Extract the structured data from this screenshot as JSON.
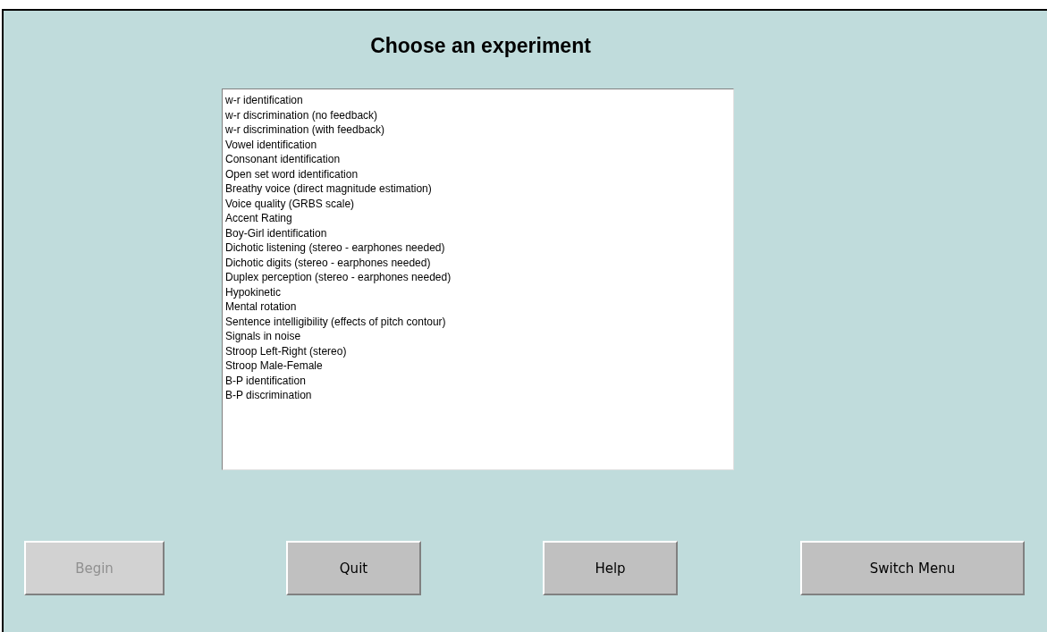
{
  "title": "Choose an experiment",
  "experiments": [
    "w-r identification",
    "w-r discrimination (no feedback)",
    "w-r discrimination (with feedback)",
    "Vowel identification",
    "Consonant identification",
    "Open set word identification",
    "Breathy voice (direct magnitude estimation)",
    "Voice quality (GRBS scale)",
    "Accent Rating",
    "Boy-Girl identification",
    "Dichotic listening (stereo - earphones needed)",
    "Dichotic digits (stereo - earphones needed)",
    "Duplex perception (stereo - earphones needed)",
    "Hypokinetic",
    "Mental rotation",
    "Sentence intelligibility (effects of pitch contour)",
    "Signals in noise",
    "Stroop Left-Right (stereo)",
    "Stroop Male-Female",
    "B-P identification",
    "B-P discrimination"
  ],
  "buttons": [
    {
      "label": "Begin",
      "disabled": true
    },
    {
      "label": "Quit",
      "disabled": false
    },
    {
      "label": "Help",
      "disabled": false
    },
    {
      "label": "Switch Menu",
      "disabled": false
    }
  ]
}
